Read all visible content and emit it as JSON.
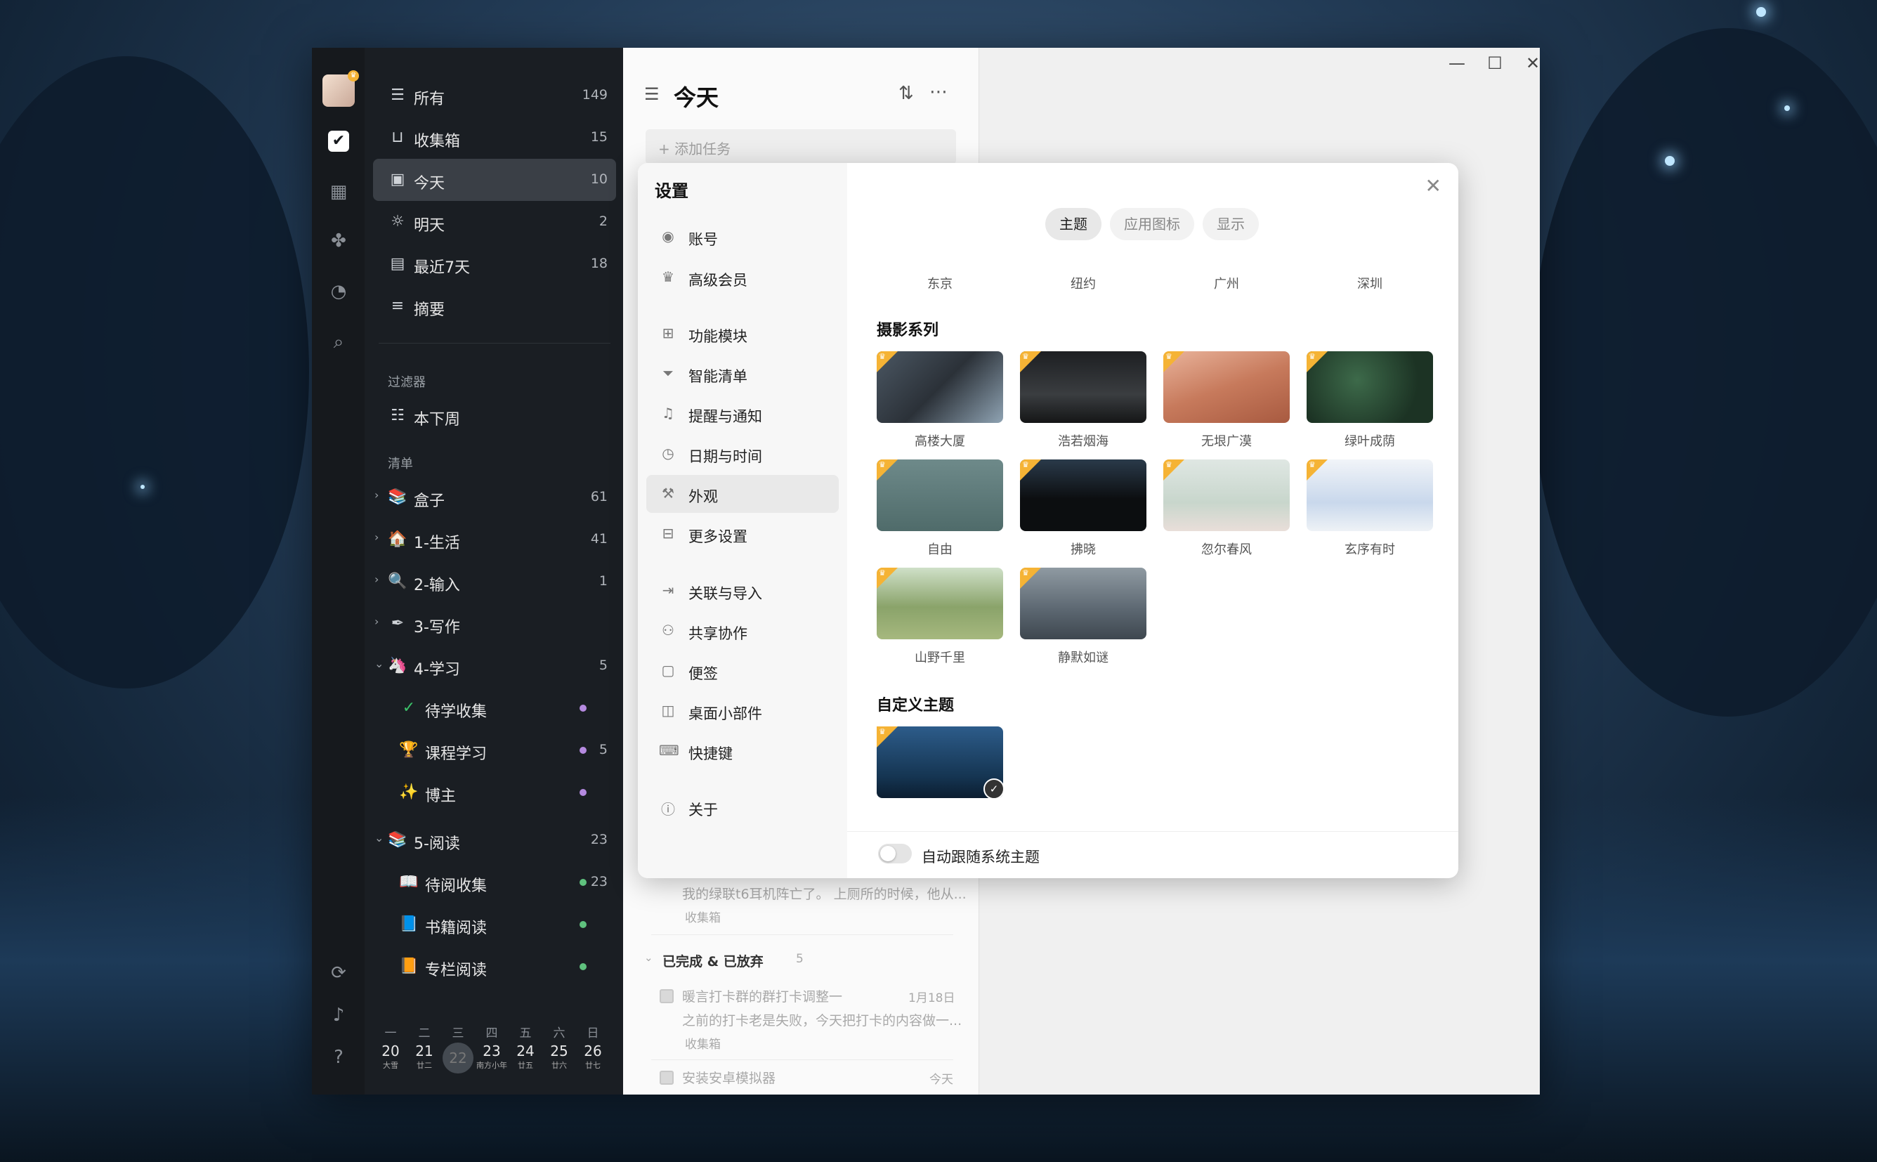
{
  "window": {
    "min": "—",
    "max": "☐",
    "close": "✕"
  },
  "sidebar": {
    "smart": [
      {
        "label": "所有",
        "count": "149",
        "icon": "stack-icon"
      },
      {
        "label": "收集箱",
        "count": "15",
        "icon": "inbox-icon"
      },
      {
        "label": "今天",
        "count": "10",
        "icon": "calendar-today-icon"
      },
      {
        "label": "明天",
        "count": "2",
        "icon": "sunrise-icon"
      },
      {
        "label": "最近7天",
        "count": "18",
        "icon": "week-icon"
      },
      {
        "label": "摘要",
        "count": "",
        "icon": "summary-icon"
      }
    ],
    "filters_header": "过滤器",
    "filters": [
      {
        "label": "本下周"
      }
    ],
    "lists_header": "清单",
    "lists": [
      {
        "label": "盒子",
        "count": "61"
      },
      {
        "label": "1-生活",
        "count": "41"
      },
      {
        "label": "2-输入",
        "count": "1"
      },
      {
        "label": "3-写作",
        "count": ""
      },
      {
        "label": "4-学习",
        "count": "5"
      },
      {
        "label": "待学收集",
        "count": ""
      },
      {
        "label": "课程学习",
        "count": "5"
      },
      {
        "label": "博主",
        "count": ""
      },
      {
        "label": "5-阅读",
        "count": "23"
      },
      {
        "label": "待阅收集",
        "count": "23"
      },
      {
        "label": "书籍阅读",
        "count": ""
      },
      {
        "label": "专栏阅读",
        "count": ""
      }
    ],
    "calendar": {
      "weekdays": [
        "一",
        "二",
        "三",
        "四",
        "五",
        "六",
        "日"
      ],
      "days": [
        {
          "d": "20",
          "s": "大雪"
        },
        {
          "d": "21",
          "s": "廿二"
        },
        {
          "d": "22",
          "s": ""
        },
        {
          "d": "23",
          "s": "南方小年"
        },
        {
          "d": "24",
          "s": "廿五"
        },
        {
          "d": "25",
          "s": "廿六"
        },
        {
          "d": "26",
          "s": "廿七"
        }
      ]
    }
  },
  "tasks": {
    "title": "今天",
    "add_placeholder": "+ 添加任务",
    "item1_text": "我的绿联t6耳机阵亡了。 上厕所的时候，他从...",
    "item1_list": "收集箱",
    "done_header": "已完成 & 已放弃",
    "done_count": "5",
    "item2_title": "暖言打卡群的群打卡调整一",
    "item2_date": "1月18日",
    "item2_text": "之前的打卡老是失败，今天把打卡的内容做一...",
    "item2_list": "收集箱",
    "item3_title": "安装安卓模拟器",
    "item3_date": "今天"
  },
  "settings": {
    "title": "设置",
    "nav": [
      {
        "label": "账号",
        "icon": "account-icon"
      },
      {
        "label": "高级会员",
        "icon": "crown-icon"
      },
      {
        "label": "功能模块",
        "icon": "modules-icon"
      },
      {
        "label": "智能清单",
        "icon": "filter-icon"
      },
      {
        "label": "提醒与通知",
        "icon": "bell-icon"
      },
      {
        "label": "日期与时间",
        "icon": "clock-icon"
      },
      {
        "label": "外观",
        "icon": "paint-icon"
      },
      {
        "label": "更多设置",
        "icon": "more-settings-icon"
      },
      {
        "label": "关联与导入",
        "icon": "import-icon"
      },
      {
        "label": "共享协作",
        "icon": "share-icon"
      },
      {
        "label": "便签",
        "icon": "note-icon"
      },
      {
        "label": "桌面小部件",
        "icon": "widget-icon"
      },
      {
        "label": "快捷键",
        "icon": "keyboard-icon"
      },
      {
        "label": "关于",
        "icon": "info-icon"
      }
    ],
    "tabs": [
      "主题",
      "应用图标",
      "显示"
    ],
    "cities": [
      "东京",
      "纽约",
      "广州",
      "深圳"
    ],
    "photo_series_title": "摄影系列",
    "photo_themes": [
      "高楼大厦",
      "浩若烟海",
      "无垠广漠",
      "绿叶成荫",
      "自由",
      "拂晓",
      "忽尔春风",
      "玄序有时",
      "山野千里",
      "静默如谜"
    ],
    "custom_title": "自定义主题",
    "auto_follow_label": "自动跟随系统主题"
  },
  "colors": {
    "accent": "#f5b335",
    "sidebar": "#11151a",
    "selected": "#3a3f46"
  }
}
